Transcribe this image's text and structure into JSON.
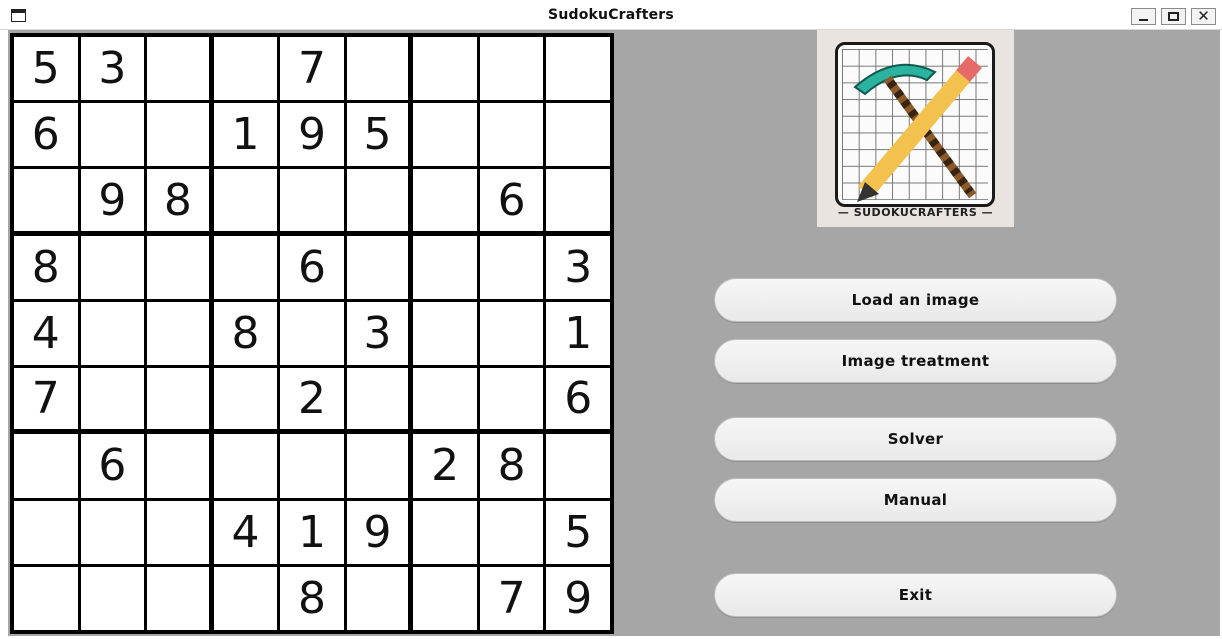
{
  "window": {
    "title": "SudokuCrafters",
    "icon": "app-window-icon",
    "controls": {
      "minimize": "minimize-icon",
      "maximize": "maximize-icon",
      "close": "close-icon",
      "close_glyph": "✕"
    }
  },
  "board": {
    "rows": [
      [
        "5",
        "3",
        "",
        "",
        "7",
        "",
        "",
        "",
        ""
      ],
      [
        "6",
        "",
        "",
        "1",
        "9",
        "5",
        "",
        "",
        ""
      ],
      [
        "",
        "9",
        "8",
        "",
        "",
        "",
        "",
        "6",
        ""
      ],
      [
        "8",
        "",
        "",
        "",
        "6",
        "",
        "",
        "",
        "3"
      ],
      [
        "4",
        "",
        "",
        "8",
        "",
        "3",
        "",
        "",
        "1"
      ],
      [
        "7",
        "",
        "",
        "",
        "2",
        "",
        "",
        "",
        "6"
      ],
      [
        "",
        "6",
        "",
        "",
        "",
        "",
        "2",
        "8",
        ""
      ],
      [
        "",
        "",
        "",
        "4",
        "1",
        "9",
        "",
        "",
        "5"
      ],
      [
        "",
        "",
        "",
        "",
        "8",
        "",
        "",
        "7",
        "9"
      ]
    ]
  },
  "logo": {
    "caption": "— SUDOKUCRAFTERS —",
    "icon": "pickaxe-pencil-logo"
  },
  "buttons": {
    "load_image": "Load an image",
    "image_treatment": "Image treatment",
    "solver": "Solver",
    "manual": "Manual",
    "exit": "Exit"
  },
  "colors": {
    "panel_background": "#a6a6a6",
    "board_lines": "#000000",
    "button_face": "#f0f0f0"
  }
}
